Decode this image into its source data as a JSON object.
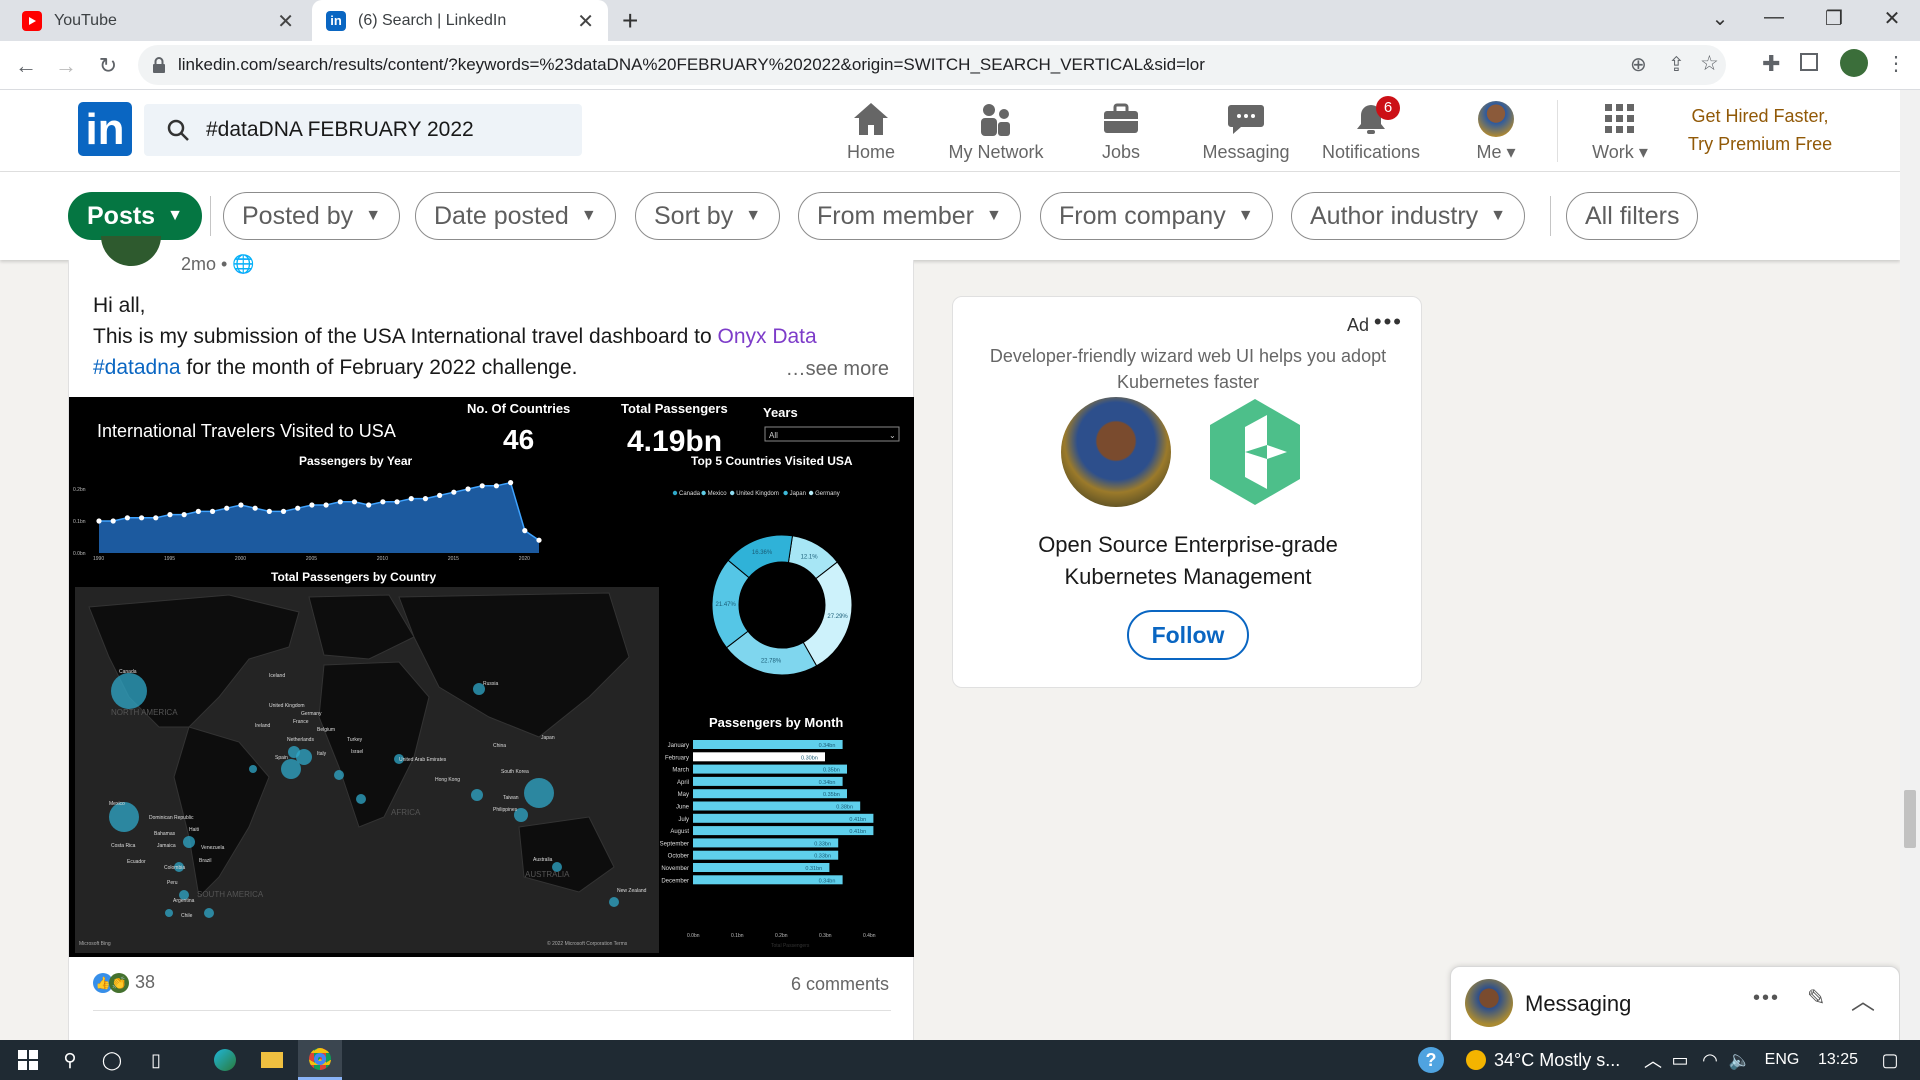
{
  "browser": {
    "tabs": [
      {
        "title": "YouTube"
      },
      {
        "title": "(6) Search | LinkedIn"
      }
    ],
    "new_tab_symbol": "+",
    "url": "linkedin.com/search/results/content/?keywords=%23dataDNA%20FEBRUARY%202022&origin=SWITCH_SEARCH_VERTICAL&sid=lor"
  },
  "linkedin": {
    "logo": "in",
    "search_value": "#dataDNA FEBRUARY 2022",
    "nav": [
      {
        "label": "Home",
        "icon": "home-icon"
      },
      {
        "label": "My Network",
        "icon": "network-icon"
      },
      {
        "label": "Jobs",
        "icon": "briefcase-icon"
      },
      {
        "label": "Messaging",
        "icon": "message-icon"
      },
      {
        "label": "Notifications",
        "icon": "bell-icon",
        "badge": "6"
      },
      {
        "label": "Me",
        "icon": "avatar"
      },
      {
        "label": "Work",
        "icon": "grid-icon"
      }
    ],
    "premium_line1": "Get Hired Faster,",
    "premium_line2": "Try Premium Free"
  },
  "filters": {
    "posts": "Posts",
    "posted_by": "Posted by",
    "date_posted": "Date posted",
    "sort_by": "Sort by",
    "from_member": "From member",
    "from_company": "From company",
    "author_industry": "Author industry",
    "all_filters": "All filters"
  },
  "post": {
    "time": "2mo •",
    "line1": "Hi all,",
    "line2_a": "This is my submission of the USA International travel dashboard to ",
    "line2_link": "Onyx Data",
    "hashtag": "#datadna",
    "line3_rest": " for the month of February 2022 challenge.",
    "see_more": "…see more",
    "reactions_count": "38",
    "comments": "6 comments"
  },
  "dashboard": {
    "title": "International Travelers Visited to USA",
    "kpi1_label": "No. Of Countries",
    "kpi1_value": "46",
    "kpi2_label": "Total Passengers",
    "kpi2_value": "4.19bn",
    "years_label": "Years",
    "years_value": "All",
    "line_title": "Passengers by Year",
    "donut_title": "Top 5 Countries Visited USA",
    "map_title": "Total Passengers by Country",
    "bar_title": "Passengers by Month",
    "copyright": "© 2022 Microsoft Corporation  Terms",
    "ms_bing": "Microsoft Bing",
    "map_labels": [
      "Canada",
      "NORTH AMERICA",
      "Mexico",
      "Dominican Republic",
      "Bahamas",
      "Haiti",
      "Costa Rica",
      "Jamaica",
      "Venezuela",
      "Ecuador",
      "Colombia",
      "Brazil",
      "Peru",
      "SOUTH AMERICA",
      "Argentina",
      "Chile",
      "Iceland",
      "United Kingdom",
      "Germany",
      "Ireland",
      "France",
      "Belgium",
      "Netherlands",
      "Turkey",
      "Spain",
      "Italy",
      "Israel",
      "United Arab Emirates",
      "Russia",
      "China",
      "Japan",
      "South Korea",
      "Hong Kong",
      "Taiwan",
      "Philippines",
      "AFRICA",
      "Australia",
      "AUSTRALIA",
      "New Zealand"
    ]
  },
  "chart_data": [
    {
      "type": "area",
      "title": "Passengers by Year",
      "x": [
        1990,
        1991,
        1992,
        1993,
        1994,
        1995,
        1996,
        1997,
        1998,
        1999,
        2000,
        2001,
        2002,
        2003,
        2004,
        2005,
        2006,
        2007,
        2008,
        2009,
        2010,
        2011,
        2012,
        2013,
        2014,
        2015,
        2016,
        2017,
        2018,
        2019,
        2020,
        2021
      ],
      "values": [
        0.1,
        0.1,
        0.11,
        0.11,
        0.11,
        0.12,
        0.12,
        0.13,
        0.13,
        0.14,
        0.15,
        0.14,
        0.13,
        0.13,
        0.14,
        0.15,
        0.15,
        0.16,
        0.16,
        0.15,
        0.16,
        0.16,
        0.17,
        0.17,
        0.18,
        0.19,
        0.2,
        0.21,
        0.21,
        0.22,
        0.07,
        0.04
      ],
      "y_tick_labels": [
        "0.0bn",
        "0.1bn",
        "0.2bn"
      ],
      "x_tick_labels": [
        "1990",
        "1995",
        "2000",
        "2005",
        "2010",
        "2015",
        "2020"
      ],
      "ylim": [
        0,
        0.2
      ],
      "color": "#1e5fa8"
    },
    {
      "type": "pie",
      "title": "Top 5 Countries Visited USA",
      "legend": [
        "Canada",
        "Mexico",
        "United Kingdom",
        "Japan",
        "Germany"
      ],
      "legend_colors": [
        "#2fa8c9",
        "#5fcde6",
        "#8fdcf0",
        "#3dbad9",
        "#b6ebf7"
      ],
      "values": [
        27.29,
        22.78,
        21.47,
        16.36,
        12.1
      ],
      "labels": [
        "27.29%",
        "22.78%",
        "21.47%",
        "16.36%",
        "12.1%"
      ],
      "legend_placement": "top"
    },
    {
      "type": "bar",
      "title": "Passengers by Month",
      "orientation": "horizontal",
      "categories": [
        "January",
        "February",
        "March",
        "April",
        "May",
        "June",
        "July",
        "August",
        "September",
        "October",
        "November",
        "December"
      ],
      "values": [
        0.34,
        0.3,
        0.35,
        0.34,
        0.35,
        0.38,
        0.41,
        0.41,
        0.33,
        0.33,
        0.31,
        0.34
      ],
      "labels": [
        "0.34bn",
        "0.30bn",
        "0.35bn",
        "0.34bn",
        "0.35bn",
        "0.38bn",
        "0.41bn",
        "0.41bn",
        "0.33bn",
        "0.33bn",
        "0.31bn",
        "0.34bn"
      ],
      "x_tick_labels": [
        "0.0bn",
        "0.1bn",
        "0.2bn",
        "0.3bn",
        "0.4bn"
      ],
      "xlim": [
        0,
        0.4
      ],
      "xlabel": "Total Passengers",
      "color": "#5fd0ec"
    }
  ],
  "ad": {
    "label": "Ad",
    "description": "Developer-friendly wizard web UI helps you adopt Kubernetes faster",
    "title_line1": "Open Source Enterprise-grade",
    "title_line2": "Kubernetes Management",
    "follow": "Follow"
  },
  "messaging": {
    "label": "Messaging"
  },
  "taskbar": {
    "weather": "34°C  Mostly s...",
    "lang": "ENG",
    "time": "13:25"
  },
  "colors": {
    "linkedin_blue": "#0a66c2",
    "posts_green": "#057642",
    "premium_gold": "#915907"
  }
}
